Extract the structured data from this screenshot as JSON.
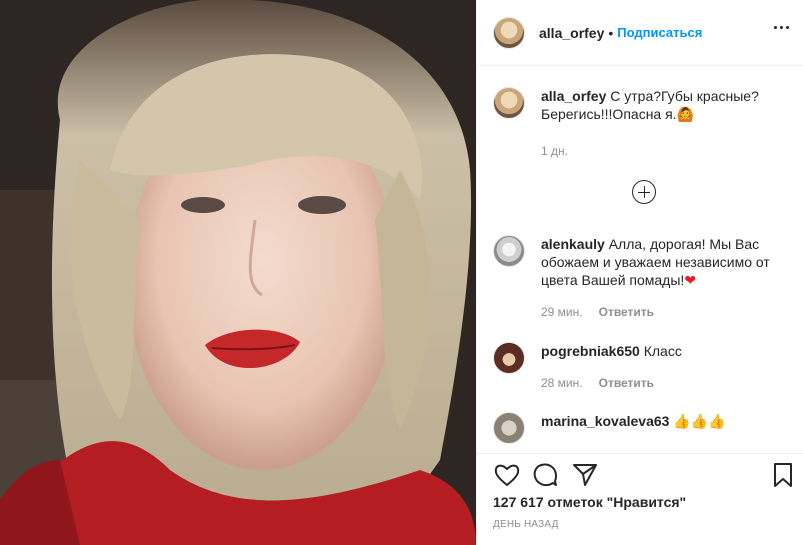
{
  "post": {
    "author": "alla_orfey",
    "separator": "•",
    "follow_label": "Подписаться",
    "caption_text": "С утра?Губы красные? Берегись!!!Опасна я.",
    "caption_emoji": "🙆",
    "caption_time": "1 дн.",
    "likes_text": "127 617 отметок \"Нравится\"",
    "date_text": "ДЕНЬ НАЗАД"
  },
  "comments": [
    {
      "username": "alenkauly",
      "text": "Алла, дорогая! Мы Вас обожаем и уважаем независимо от цвета Вашей помады!",
      "emoji": "❤",
      "time": "29 мин.",
      "reply_label": "Ответить"
    },
    {
      "username": "pogrebniak650",
      "text": "Класс",
      "time": "28 мин.",
      "reply_label": "Ответить"
    },
    {
      "username": "marina_kovaleva63",
      "text": "👍👍👍"
    }
  ],
  "icons": {
    "more": "more-options-icon",
    "load_more": "plus-circle-icon",
    "like": "heart-icon",
    "comment": "comment-icon",
    "share": "paper-plane-icon",
    "save": "bookmark-icon"
  },
  "colors": {
    "accent": "#0095f6",
    "text": "#262626",
    "muted": "#8e8e8e",
    "heart": "#ed1c24"
  }
}
